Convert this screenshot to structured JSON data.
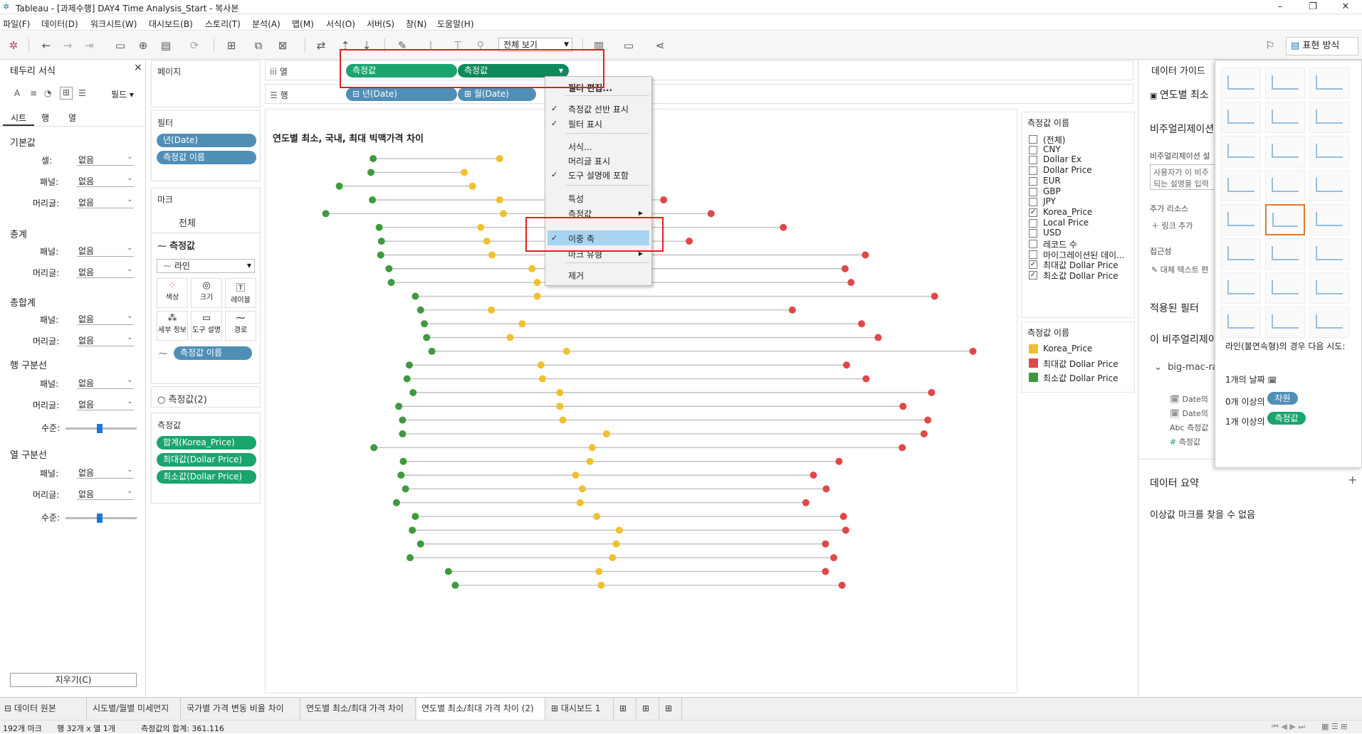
{
  "title": "Tableau - [과제수행] DAY4 Time Analysis_Start - 복사본",
  "menu": [
    "파일(F)",
    "데이터(D)",
    "워크시트(W)",
    "대시보드(B)",
    "스토리(T)",
    "분석(A)",
    "맵(M)",
    "서식(O)",
    "서버(S)",
    "창(N)",
    "도움말(H)"
  ],
  "toolbar": {
    "view_select": "전체 보기",
    "show_me": "표현 방식"
  },
  "format_panel": {
    "title": "테두리 서식",
    "fields_label": "필드",
    "tabs": [
      "시트",
      "행",
      "열"
    ],
    "sections": {
      "default": "기본값",
      "cell": "셀:",
      "pane": "패널:",
      "header": "머리글:",
      "total": "총계",
      "grand_total": "총합계",
      "row_divider": "행 구분선",
      "level": "수준:",
      "col_divider": "열 구분선"
    },
    "none": "없음",
    "clear": "지우기(C)"
  },
  "shelves": {
    "pages": "페이지",
    "columns_label": "열",
    "rows_label": "행",
    "columns_pills": [
      "측정값",
      "측정값"
    ],
    "rows_pills": [
      "년(Date)",
      "월(Date)"
    ],
    "filters_title": "필터",
    "filters": [
      "년(Date)",
      "측정값 이름"
    ],
    "marks_title": "마크",
    "marks_all": "전체",
    "marks_measure": "측정값",
    "marks_type": "라인",
    "marks_buttons": [
      "색상",
      "크기",
      "레이블",
      "세부 정보",
      "도구 설명",
      "경로"
    ],
    "marks_pill": "측정값 이름",
    "marks_measure2": "측정값(2)",
    "measures_title": "측정값",
    "measures": [
      "합계(Korea_Price)",
      "최대값(Dollar Price)",
      "최소값(Dollar Price)"
    ]
  },
  "context_menu": {
    "items": [
      "필터 편집...",
      "측정값 선반 표시",
      "필터 표시",
      "서식...",
      "머리글 표시",
      "도구 설명에 포함",
      "특성",
      "측정값",
      "이중 축",
      "마크 유형",
      "제거"
    ],
    "checked": [
      "측정값 선반 표시",
      "필터 표시",
      "도구 설명에 포함",
      "이중 축"
    ]
  },
  "view": {
    "title": "연도별 최소, 국내, 최대 빅맥가격 차이"
  },
  "filter_legend": {
    "title": "측정값 이름",
    "items": [
      "(전체)",
      "CNY",
      "Dollar Ex",
      "Dollar Price",
      "EUR",
      "GBP",
      "JPY",
      "Korea_Price",
      "Local Price",
      "USD",
      "레코드 수",
      "마이그레이션된 데이...",
      "최대값 Dollar Price",
      "최소값 Dollar Price"
    ],
    "checked": [
      false,
      false,
      false,
      false,
      false,
      false,
      false,
      true,
      false,
      false,
      false,
      false,
      true,
      true
    ]
  },
  "color_legend": {
    "title": "측정값 이름",
    "items": [
      {
        "label": "Korea_Price",
        "color": "#f0c030"
      },
      {
        "label": "최대값 Dollar Price",
        "color": "#e04848"
      },
      {
        "label": "최소값 Dollar Price",
        "color": "#3e9a3e"
      }
    ]
  },
  "guide": {
    "title": "데이터 가이드",
    "sheet": "연도별 최소",
    "viz_desc": "비주얼리제이션",
    "viz_desc_label": "비주얼리제이션 설",
    "viz_desc_placeholder": "사용자가 이 비주\n되는 설명을 입력",
    "more_resources": "추가 리소스",
    "link_add": "링크 추가",
    "accessibility": "접근성",
    "alt_text": "대체 텍스트 편",
    "applied_filters": "적용된 필터",
    "this_viz": "이 비주얼리제이",
    "datasource": "big-mac-ra",
    "fields": [
      "Date의",
      "Date의",
      "측정값",
      "측정값"
    ],
    "data_summary": "데이터 요약",
    "no_outliers": "이상값 마크를 찾을 수 없음"
  },
  "showme_hint": {
    "text": "라인(불연속형)의 경우 다음 시도:",
    "row1": "1개의 날짜",
    "row2_prefix": "0개 이상의",
    "row2_pill": "차원",
    "row3_prefix": "1개 이상의",
    "row3_pill": "측정값"
  },
  "tabs": [
    "데이터 원본",
    "시도별/월별 미세먼지",
    "국가별 가격 변동 비율 차이",
    "연도별 최소/최대 가격 차이",
    "연도별 최소/최대 가격 차이 (2)",
    "대시보드 1"
  ],
  "active_tab": 4,
  "status": {
    "marks": "192개 마크",
    "rows": "행 32개 x 열 1개",
    "sum": "측정값의 합계: 361.116"
  },
  "chart_data": {
    "type": "dumbbell",
    "note_units": "horizontal position in value-axis fraction (axis unlabeled)",
    "series": [
      {
        "name": "최소값 Dollar Price",
        "color": "#3e9a3e"
      },
      {
        "name": "Korea_Price",
        "color": "#f0c030"
      },
      {
        "name": "최대값 Dollar Price",
        "color": "#e04848"
      }
    ],
    "rows": [
      [
        0.143,
        0.311,
        null
      ],
      [
        0.14,
        0.264,
        null
      ],
      [
        0.098,
        0.275,
        null
      ],
      [
        0.142,
        0.311,
        0.529
      ],
      [
        0.08,
        0.316,
        0.592
      ],
      [
        0.151,
        0.286,
        0.688
      ],
      [
        0.154,
        0.294,
        0.563
      ],
      [
        0.153,
        0.301,
        0.797
      ],
      [
        0.164,
        0.354,
        0.77
      ],
      [
        0.167,
        0.361,
        0.778
      ],
      [
        0.199,
        0.361,
        0.889
      ],
      [
        0.206,
        0.3,
        0.7
      ],
      [
        0.211,
        0.341,
        0.792
      ],
      [
        0.214,
        0.325,
        0.814
      ],
      [
        0.221,
        0.4,
        0.94
      ],
      [
        0.191,
        0.366,
        0.772
      ],
      [
        0.188,
        0.368,
        0.798
      ],
      [
        0.196,
        0.391,
        0.885
      ],
      [
        0.177,
        0.391,
        0.847
      ],
      [
        0.182,
        0.395,
        0.88
      ],
      [
        0.182,
        0.453,
        0.875
      ],
      [
        0.144,
        0.434,
        0.846
      ],
      [
        0.183,
        0.431,
        0.762
      ],
      [
        0.18,
        0.412,
        0.728
      ],
      [
        0.186,
        0.421,
        0.745
      ],
      [
        0.174,
        0.418,
        0.718
      ],
      [
        0.199,
        0.44,
        0.768
      ],
      [
        0.195,
        0.47,
        0.771
      ],
      [
        0.206,
        0.466,
        0.744
      ],
      [
        0.192,
        0.461,
        0.755
      ],
      [
        0.243,
        0.443,
        0.744
      ],
      [
        0.252,
        0.446,
        0.766
      ]
    ]
  }
}
